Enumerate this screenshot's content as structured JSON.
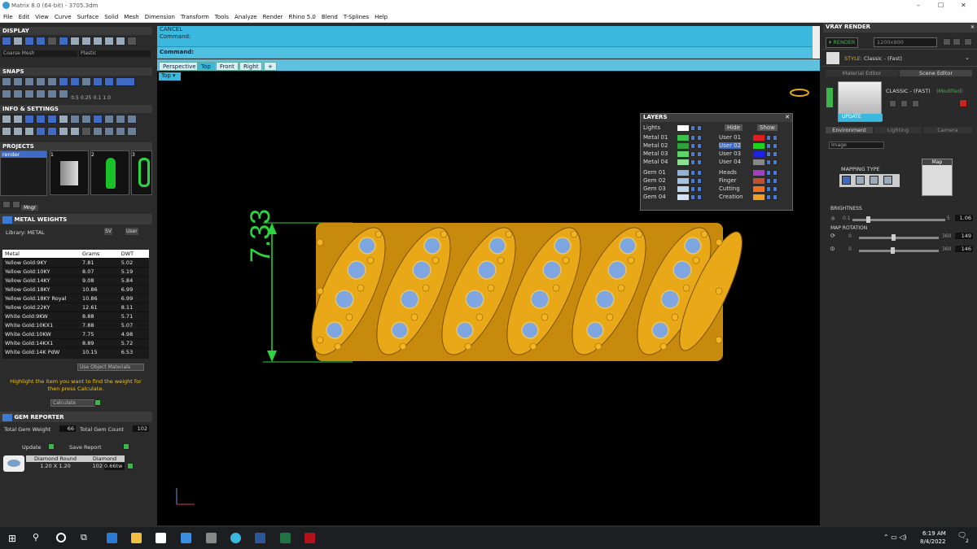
{
  "window": {
    "title": "Matrix 8.0 (64-bit) - 3705.3dm",
    "minimize": "–",
    "maximize": "☐",
    "close": "✕"
  },
  "menu": [
    "File",
    "Edit",
    "View",
    "Curve",
    "Surface",
    "Solid",
    "Mesh",
    "Dimension",
    "Transform",
    "Tools",
    "Analyze",
    "Render",
    "Rhino 5.0",
    "Blend",
    "T-Splines",
    "Help"
  ],
  "display": {
    "title": "DISPLAY",
    "mesh_select": "Coarse Mesh",
    "shade_select": "Plastic"
  },
  "snaps": {
    "title": "SNAPS",
    "values": [
      "0.5",
      "0.25",
      "0.1",
      "1.0"
    ]
  },
  "info": {
    "title": "INFO & SETTINGS"
  },
  "projects": {
    "title": "PROJECTS",
    "items": [
      "render"
    ],
    "thumbs": [
      "1",
      "2",
      "3"
    ],
    "mngr": "Mngr"
  },
  "metal_weights": {
    "title": "METAL WEIGHTS",
    "library_label": "Library: METAL",
    "sv_label": "SV",
    "user_label": "User",
    "columns": [
      "Metal",
      "Grams",
      "DWT"
    ],
    "rows": [
      [
        "Yellow Gold:9KY",
        "7.81",
        "5.02"
      ],
      [
        "Yellow Gold:10KY",
        "8.07",
        "5.19"
      ],
      [
        "Yellow Gold:14KY",
        "9.08",
        "5.84"
      ],
      [
        "Yellow Gold:18KY",
        "10.86",
        "6.99"
      ],
      [
        "Yellow Gold:18KY Royal",
        "10.86",
        "6.99"
      ],
      [
        "Yellow Gold:22KY",
        "12.61",
        "8.11"
      ],
      [
        "White Gold:9KW",
        "8.88",
        "5.71"
      ],
      [
        "White Gold:10KX1",
        "7.88",
        "5.07"
      ],
      [
        "White Gold:10KW",
        "7.75",
        "4.98"
      ],
      [
        "White Gold:14KX1",
        "8.89",
        "5.72"
      ],
      [
        "White Gold:14K PdW",
        "10.15",
        "6.53"
      ]
    ],
    "use_object": "Use Object Materials",
    "hint": "Highlight the item you want to find the weight for then press Calculate.",
    "calculate": "Calculate"
  },
  "gem_reporter": {
    "title": "GEM REPORTER",
    "total_weight_label": "Total Gem Weight",
    "total_weight": "66",
    "total_count_label": "Total Gem Count",
    "total_count": "102",
    "update": "Update",
    "save_report": "Save Report",
    "gem_cols": [
      "Diamond Round",
      "Diamond"
    ],
    "gem_size": "1.20 X 1.20",
    "gem_count": "102",
    "gem_weight": "0.66tw"
  },
  "command": {
    "line1": "CANCEL",
    "line2": "Command:",
    "prompt": "Command:"
  },
  "view_tabs": [
    "Perspective",
    "Top",
    "Front",
    "Right"
  ],
  "active_view": "Top",
  "dimension_value": "7.33",
  "layers": {
    "title": "LAYERS",
    "lights": "Lights",
    "hide": "Hide",
    "show": "Show",
    "left": [
      {
        "name": "Metal 01",
        "color": "#3cc24a"
      },
      {
        "name": "Metal 02",
        "color": "#2fa23a"
      },
      {
        "name": "Metal 03",
        "color": "#5cd46a"
      },
      {
        "name": "Metal 04",
        "color": "#8be08f"
      },
      {
        "name": "Gem 01",
        "color": "#8fb2d6"
      },
      {
        "name": "Gem 02",
        "color": "#a5c2e0"
      },
      {
        "name": "Gem 03",
        "color": "#bdd3ea"
      },
      {
        "name": "Gem 04",
        "color": "#d3e3f3"
      }
    ],
    "right": [
      {
        "name": "User 01",
        "color": "#e02020"
      },
      {
        "name": "User 02",
        "color": "#20d020"
      },
      {
        "name": "User 03",
        "color": "#2020e0"
      },
      {
        "name": "User 04",
        "color": "#888888"
      },
      {
        "name": "Heads",
        "color": "#a040c0"
      },
      {
        "name": "Finger",
        "color": "#c05030"
      },
      {
        "name": "Cutting",
        "color": "#f07020"
      },
      {
        "name": "Creation",
        "color": "#f0a020"
      }
    ]
  },
  "vray": {
    "title": "VRAY RENDER",
    "render": "RENDER",
    "resolution": "1200x900",
    "style_label": "STYLE:",
    "style": "Classic - (Fast)",
    "tabs": [
      "Material Editor",
      "Scene Editor"
    ],
    "preset": "CLASSIC - (FAST)",
    "modified": "(Modified)",
    "update": "UPDATE",
    "env_tabs": [
      "Environment",
      "Lighting",
      "Camera"
    ],
    "env_select": "Image",
    "mapping_type": "MAPPING TYPE",
    "map_label": "Map",
    "brightness_label": "BRIGHTNESS",
    "brightness_min": "0.1",
    "brightness_max": "5",
    "brightness": "1.06",
    "rotation_label": "MAP ROTATION",
    "rot1_min": "0",
    "rot1_max": "360",
    "rot1": "149",
    "rot2_min": "0",
    "rot2_max": "360",
    "rot2": "146"
  },
  "taskbar": {
    "time": "6:19 AM",
    "date": "8/4/2022",
    "notif": "2"
  }
}
